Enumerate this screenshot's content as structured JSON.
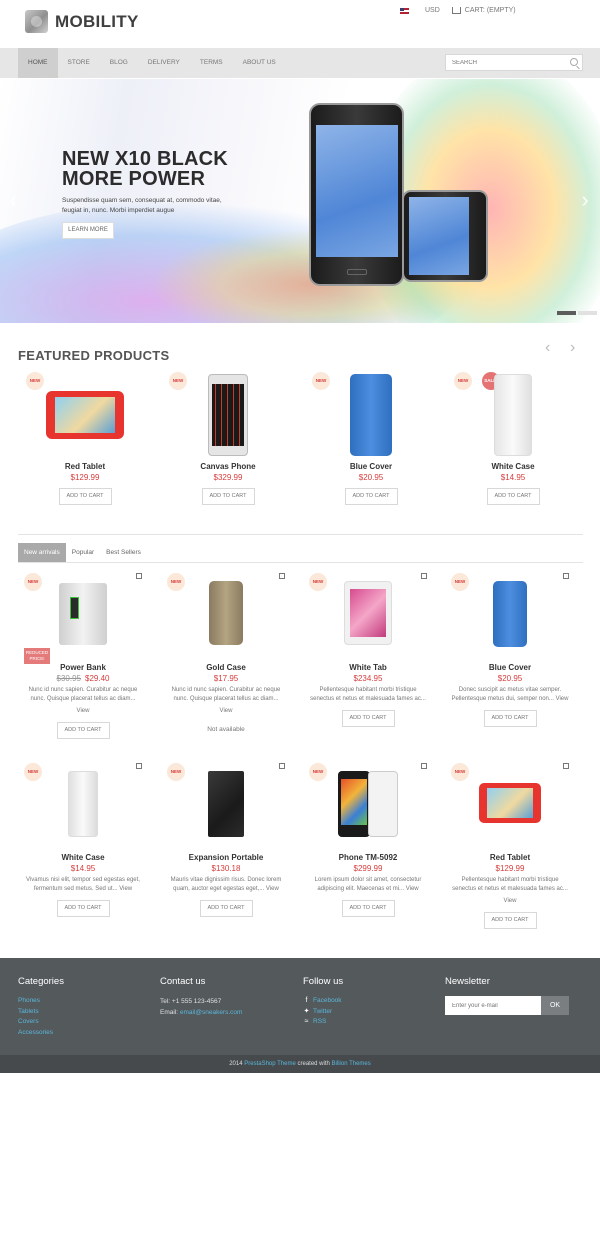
{
  "header": {
    "logo_text": "MOBILITY",
    "currency": "USD",
    "cart_label": "CART: (EMPTY)"
  },
  "nav": {
    "items": [
      "HOME",
      "STORE",
      "BLOG",
      "DELIVERY",
      "TERMS",
      "ABOUT US"
    ],
    "active": "HOME",
    "search_placeholder": "SEARCH"
  },
  "slider": {
    "title_line1": "NEW X10 BLACK",
    "title_line2": "MORE POWER",
    "text": "Suspendisse quam sem, consequat at, commodo vitae, feugiat in, nunc. Morbi imperdiet augue",
    "button": "LEARN MORE"
  },
  "featured": {
    "title": "FEATURED PRODUCTS",
    "products": [
      {
        "name": "Red Tablet",
        "price": "$129.99",
        "badge": "NEW",
        "cart": "ADD TO CART"
      },
      {
        "name": "Canvas Phone",
        "price": "$329.99",
        "badge": "NEW",
        "cart": "ADD TO CART"
      },
      {
        "name": "Blue Cover",
        "price": "$20.95",
        "badge": "NEW",
        "cart": "ADD TO CART"
      },
      {
        "name": "White Case",
        "price": "$14.95",
        "badge": "NEW",
        "sale": "SALE!",
        "cart": "ADD TO CART"
      }
    ]
  },
  "tabs": {
    "items": [
      "New arrivals",
      "Popular",
      "Best Sellers"
    ],
    "active": "New arrivals"
  },
  "grid": {
    "row1": [
      {
        "name": "Power Bank",
        "old_price": "$30.95",
        "price": "$29.40",
        "badge": "NEW",
        "reduced": "REDUCED PRICE!",
        "desc": "Nunc id nunc sapien. Curabitur ac neque nunc. Quisque placerat tellus ac diam...",
        "view": "View",
        "cart": "ADD TO CART"
      },
      {
        "name": "Gold Case",
        "price": "$17.95",
        "badge": "NEW",
        "desc": "Nunc id nunc sapien. Curabitur ac neque nunc. Quisque placerat tellus ac diam...",
        "view": "View",
        "na": "Not available"
      },
      {
        "name": "White Tab",
        "price": "$234.95",
        "badge": "NEW",
        "desc": "Pellentesque habitant morbi tristique senectus et netus et malesuada fames ac...",
        "view": "View",
        "cart": "ADD TO CART"
      },
      {
        "name": "Blue Cover",
        "price": "$20.95",
        "badge": "NEW",
        "desc": "Donec suscipit ac metus vitae semper. Pellentesque metus dui, semper non...",
        "view": "View",
        "cart": "ADD TO CART"
      }
    ],
    "row2": [
      {
        "name": "White Case",
        "price": "$14.95",
        "badge": "NEW",
        "desc": "Vivamus nisi elit, tempor sed egestas eget, fermentum sed metus. Sed ut...",
        "view": "View",
        "cart": "ADD TO CART"
      },
      {
        "name": "Expansion Portable",
        "price": "$130.18",
        "badge": "NEW",
        "desc": "Mauris vitae dignissim risus. Donec lorem quam, auctor eget egestas eget,...",
        "view": "View",
        "cart": "ADD TO CART"
      },
      {
        "name": "Phone TM-5092",
        "price": "$299.99",
        "badge": "NEW",
        "desc": "Lorem ipsum dolor sit amet, consectetur adipiscing elit. Maecenas et mi...",
        "view": "View",
        "cart": "ADD TO CART"
      },
      {
        "name": "Red Tablet",
        "price": "$129.99",
        "badge": "NEW",
        "desc": "Pellentesque habitant morbi tristique senectus et netus et malesuada fames ac...",
        "view": "View",
        "cart": "ADD TO CART"
      }
    ]
  },
  "footer": {
    "categories_title": "Categories",
    "categories": [
      "Phones",
      "Tablets",
      "Covers",
      "Accessories"
    ],
    "contact_title": "Contact us",
    "tel": "Tel: +1 555 123-4567",
    "email_label": "Email:",
    "email": "email@sneakers.com",
    "follow_title": "Follow us",
    "social": [
      "Facebook",
      "Twitter",
      "RSS"
    ],
    "newsletter_title": "Newsletter",
    "newsletter_placeholder": "Enter your e-mail",
    "newsletter_button": "OK",
    "copyright_pre": "2014",
    "copyright_link1": "PrestaShop Theme",
    "copyright_mid": "created with",
    "copyright_link2": "Billion Themes"
  },
  "colors": {
    "price_red": "#d63c3c",
    "link_blue": "#5ab6d9",
    "footer_bg": "#54595c"
  }
}
